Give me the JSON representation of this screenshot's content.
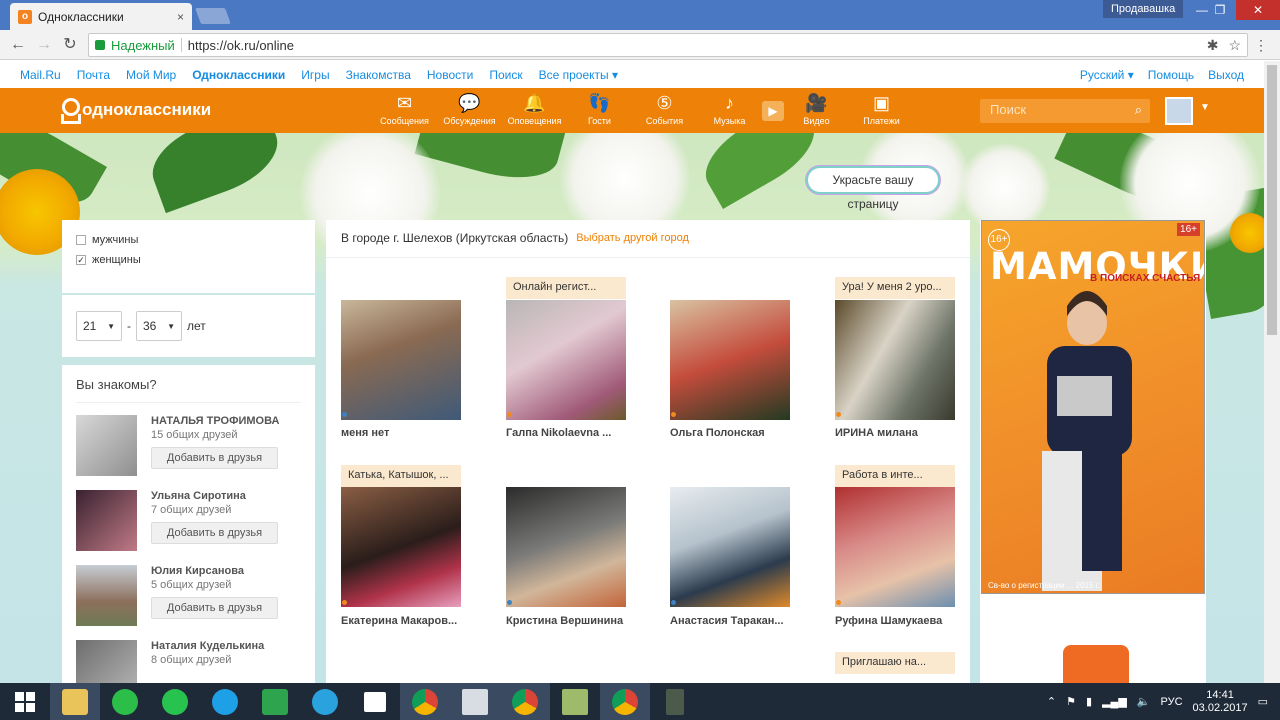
{
  "browser": {
    "tab_title": "Одноклассники",
    "tab_close": "×",
    "profile": "Продавашка",
    "secure_label": "Надежный",
    "url": "https://ok.ru/online",
    "min": "—",
    "max": "❐",
    "close": "✕"
  },
  "mailru_bar": {
    "links": [
      "Mail.Ru",
      "Почта",
      "Мой Мир",
      "Одноклассники",
      "Игры",
      "Знакомства",
      "Новости",
      "Поиск",
      "Все проекты ▾"
    ],
    "language": "Русский ▾",
    "help": "Помощь",
    "logout": "Выход"
  },
  "ok_header": {
    "logo_text": "одноклассники",
    "nav": [
      {
        "label": "Сообщения",
        "icon": "✉"
      },
      {
        "label": "Обсуждения",
        "icon": "💬"
      },
      {
        "label": "Оповещения",
        "icon": "🔔"
      },
      {
        "label": "Гости",
        "icon": "👣"
      },
      {
        "label": "События",
        "icon": "⑤"
      },
      {
        "label": "Музыка",
        "icon": "♪"
      },
      {
        "label": "Видео",
        "icon": "🎥"
      },
      {
        "label": "Платежи",
        "icon": "▣"
      }
    ],
    "search_placeholder": "Поиск"
  },
  "banner": {
    "decorate_button": "Украсьте вашу страницу"
  },
  "filters": {
    "male": "мужчины",
    "female": "женщины",
    "female_checked": "✓",
    "age_from": "21",
    "age_to": "36",
    "age_sep": "-",
    "age_unit": "лет"
  },
  "know": {
    "title": "Вы знакомы?",
    "add_label": "Добавить в друзья",
    "people": [
      {
        "name": "НАТАЛЬЯ ТРОФИМОВА",
        "mutual": "15 общих друзей"
      },
      {
        "name": "Ульяна Сиротина",
        "mutual": "7 общих друзей"
      },
      {
        "name": "Юлия Кирсанова",
        "mutual": "5 общих друзей"
      },
      {
        "name": "Наталия Кудель​кина",
        "mutual": "8 общих друзей"
      }
    ]
  },
  "center": {
    "city_text": "В городе г. Шелехов (Иркутская область)",
    "change_city": "Выбрать другой город",
    "cards": [
      {
        "name": "меня нет",
        "tag": ""
      },
      {
        "name": "Галпа Nikolaevna ...",
        "tag": "Онлайн регист..."
      },
      {
        "name": "Ольга Полонская",
        "tag": ""
      },
      {
        "name": "ИРИНА милана",
        "tag": "Ура! У меня 2 уро..."
      },
      {
        "name": "Екатерина Макаров...",
        "tag": "Катька, Катышок, ..."
      },
      {
        "name": "Кристина Вершинина",
        "tag": ""
      },
      {
        "name": "Анастасия Таракан...",
        "tag": ""
      },
      {
        "name": "Руфина Шамукаева",
        "tag": "Работа в инте..."
      },
      {
        "name": "",
        "tag": "Приглашаю на..."
      }
    ]
  },
  "ad": {
    "title": "МАМОЧКИ",
    "subtitle": "В ПОИСКАХ СЧАСТЬЯ",
    "age_left": "16+",
    "age_right": "16+",
    "fine_print": "Св-во о регистрации ... 2015 г."
  },
  "taskbar": {
    "time": "14:41",
    "date": "03.02.2017",
    "lang": "РУС"
  },
  "colors": {
    "ok_orange": "#ee8208",
    "link_blue": "#168de2",
    "tag_bg": "#fbe9cf"
  }
}
